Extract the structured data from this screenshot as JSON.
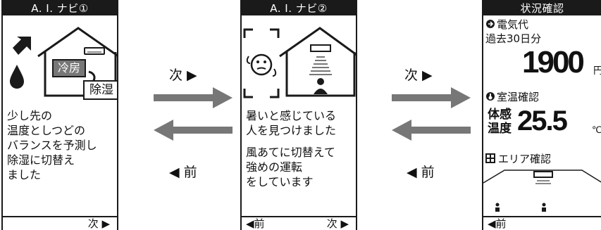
{
  "screen1": {
    "title": "A. I. ナビ①",
    "badge_cool": "冷房",
    "badge_dehumid": "除湿",
    "message": "少し先の\n温度としつどの\nバランスを予測し\n除湿に切替え\nました",
    "footer_next": "次 ▶"
  },
  "screen2": {
    "title": "A. I. ナビ②",
    "message1": "暑いと感じている\n人を見つけました",
    "message2": "風あてに切替えて\n強めの運転\nをしています",
    "footer_prev": "◀前",
    "footer_next": "次 ▶"
  },
  "screen3": {
    "title": "状況確認",
    "electric_label": "電気代",
    "period": "過去30日分",
    "cost_value": "1900",
    "cost_unit": "円",
    "temp_label": "室温確認",
    "feels_label_1": "体感",
    "feels_label_2": "温度",
    "temp_value": "25.5",
    "temp_unit": "℃",
    "area_label": "エリア確認",
    "footer_prev": "◀前"
  },
  "nav": {
    "next_label": "次 ▶",
    "prev_label": "◀ 前"
  }
}
